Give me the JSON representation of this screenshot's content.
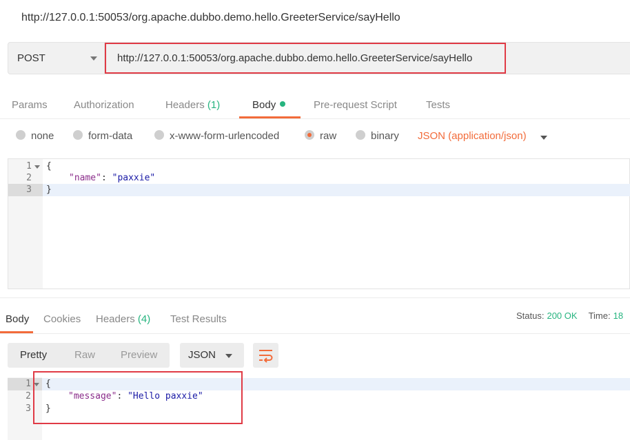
{
  "window": {
    "title": "http://127.0.0.1:50053/org.apache.dubbo.demo.hello.GreeterService/sayHello"
  },
  "request": {
    "method": "POST",
    "url": "http://127.0.0.1:50053/org.apache.dubbo.demo.hello.GreeterService/sayHello"
  },
  "request_tabs": {
    "params": "Params",
    "authorization": "Authorization",
    "headers": "Headers",
    "headers_count": "(1)",
    "body": "Body",
    "prerequest": "Pre-request Script",
    "tests": "Tests"
  },
  "body_types": {
    "none": "none",
    "form_data": "form-data",
    "urlencoded": "x-www-form-urlencoded",
    "raw": "raw",
    "binary": "binary",
    "selected": "raw",
    "content_type": "JSON (application/json)"
  },
  "request_body": {
    "lines": [
      {
        "num": "1",
        "text": "{"
      },
      {
        "num": "2",
        "key": "\"name\"",
        "sep": ": ",
        "value": "\"paxxie\""
      },
      {
        "num": "3",
        "text": "}"
      }
    ]
  },
  "response_tabs": {
    "body": "Body",
    "cookies": "Cookies",
    "headers": "Headers",
    "headers_count": "(4)",
    "test_results": "Test Results"
  },
  "response_status": {
    "status_label": "Status:",
    "status_value": "200 OK",
    "time_label": "Time:",
    "time_value": "18"
  },
  "response_view": {
    "pretty": "Pretty",
    "raw": "Raw",
    "preview": "Preview",
    "format": "JSON"
  },
  "response_body": {
    "lines": [
      {
        "num": "1",
        "text": "{"
      },
      {
        "num": "2",
        "key": "\"message\"",
        "sep": ": ",
        "value": "\"Hello paxxie\""
      },
      {
        "num": "3",
        "text": "}"
      }
    ]
  },
  "colors": {
    "accent": "#f26b3a",
    "success": "#26b47f",
    "highlight_box": "#e03a45"
  }
}
